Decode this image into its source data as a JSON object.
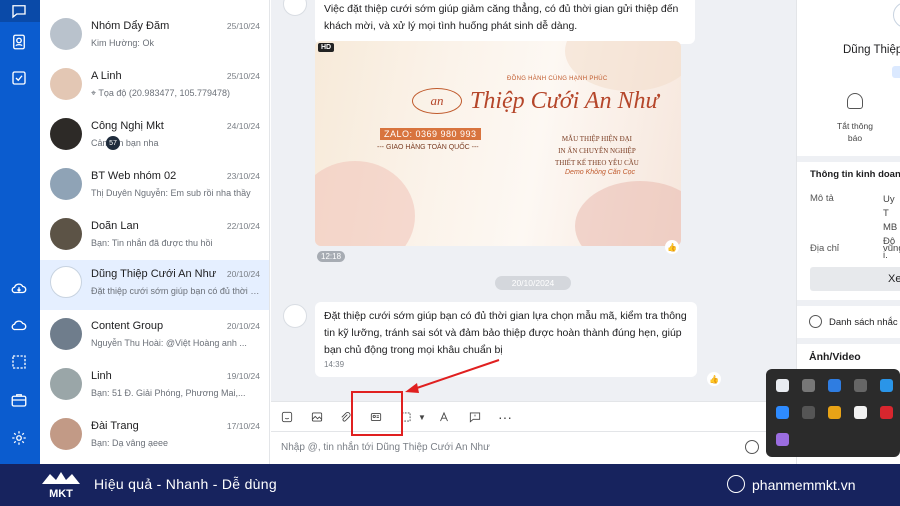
{
  "conversations": [
    {
      "name": "Nhóm Dẩy Đăm",
      "time": "25/10/24",
      "preview": "Kim Hường: Ok"
    },
    {
      "name": "A Linh",
      "time": "25/10/24",
      "preview": "Tọa độ (20.983477, 105.779478)"
    },
    {
      "name": "Công Nghị Mkt",
      "time": "24/10/24",
      "preview": "Cảm ơn bạn nha"
    },
    {
      "name": "BT Web nhóm 02",
      "time": "23/10/24",
      "preview": "Thị Duyên Nguyễn: Em sub rồi nha thầy",
      "badge": "57"
    },
    {
      "name": "Doãn Lan",
      "time": "22/10/24",
      "preview": "Bạn: Tin nhắn đã được thu hồi"
    },
    {
      "name": "Dũng Thiệp Cưới An Như",
      "time": "20/10/24",
      "preview": "Đặt thiệp cưới sớm giúp bạn có đủ thời gian"
    },
    {
      "name": "Content Group",
      "time": "20/10/24",
      "preview": "Nguyễn Thu Hoài: @Việt Hoàng anh ..."
    },
    {
      "name": "Linh",
      "time": "19/10/24",
      "preview": "Bạn: 51 Đ. Giải Phóng, Phương Mai,..."
    },
    {
      "name": "Đài Trang",
      "time": "17/10/24",
      "preview": "Bạn: Dạ vâng ạeee"
    }
  ],
  "chat": {
    "msg1": "Việc đặt thiệp cưới sớm giúp giảm căng thẳng, có đủ thời gian gửi thiệp đến khách mời, và xử lý mọi tình huống phát sinh dễ dàng.",
    "image": {
      "hd": "HD",
      "tagline": "ĐỒNG HÀNH CÙNG HẠNH PHÚC",
      "logo": "an",
      "brand": "Thiệp Cưới An Như",
      "zalo": "ZALO: 0369 980 993",
      "delivery": "--- GIAO HÀNG TOÀN QUỐC ---",
      "services": "MẪU THIỆP HIỆN ĐẠI\nIN ẤN CHUYÊN NGHIỆP\nTHIẾT KẾ THEO YÊU CẦU",
      "demo": "Demo Không Căn Cọc",
      "time": "12:18"
    },
    "date_divider": "20/10/2024",
    "msg2": "Đặt thiệp cưới sớm giúp bạn có đủ thời gian lựa chọn mẫu mã, kiểm tra thông tin kỹ lưỡng, tránh sai sót và đảm bảo thiệp được hoàn thành đúng hẹn, giúp bạn chủ động trong mọi khâu chuẩn bị",
    "msg2_time": "14:39",
    "input_placeholder": "Nhập @, tin nhắn tới Dũng Thiệp Cưới An Như"
  },
  "right_panel": {
    "name": "Dũng Thiệp",
    "mute_label": "Tắt thông báo",
    "info_title": "Thông tin kinh doanh",
    "desc_label": "Mô tả",
    "desc_value": "Uy T MB Đội.",
    "address_label": "Địa chỉ",
    "address_value": "vũng",
    "view_button": "Xe",
    "reminder": "Danh sách nhắc h",
    "media_title": "Ảnh/Video"
  },
  "footer": {
    "brand": "MKT",
    "slogan": "Hiệu quả - Nhanh - Dễ dùng",
    "site": "phanmemmkt.vn"
  },
  "colors": {
    "nav_blue": "#0b5ccf",
    "footer_navy": "#17235e",
    "highlight_red": "#e02020"
  }
}
